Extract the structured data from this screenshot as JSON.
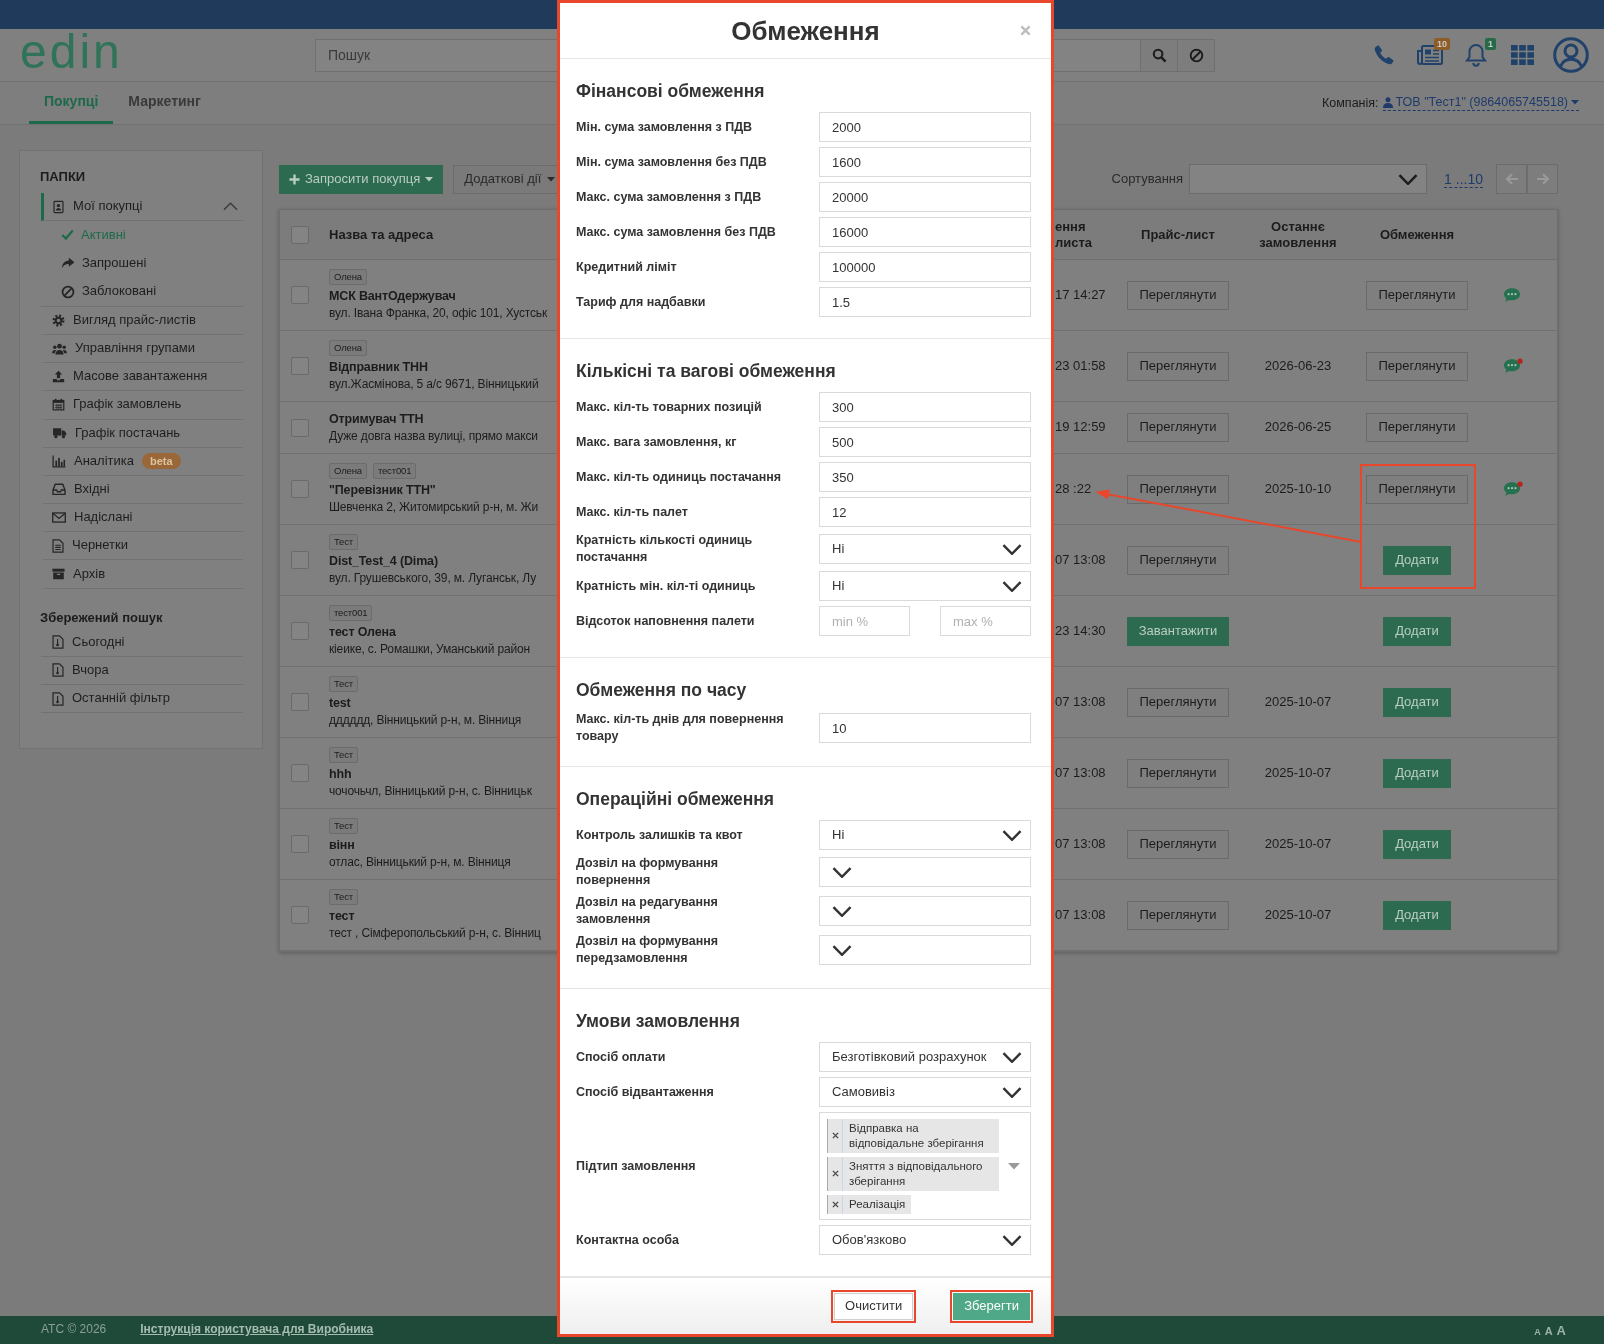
{
  "header": {
    "logo": "edin",
    "search": {
      "placeholder": "Пошук"
    },
    "icons": [
      {
        "kind": "phone"
      },
      {
        "kind": "news",
        "badge": "10",
        "color": "#8d5c27"
      },
      {
        "kind": "bell",
        "badge": "1",
        "color": "#276a48"
      },
      {
        "kind": "apps"
      },
      {
        "kind": "account"
      }
    ]
  },
  "tabs": [
    {
      "label": "Покупці",
      "selected": true
    },
    {
      "label": "Маркетинг",
      "selected": false
    }
  ],
  "company": {
    "label": "Компанія:",
    "value": "ТОВ \"Тест1\" (9864065745518)"
  },
  "sidebar": {
    "title": "ПАПКИ",
    "items": [
      {
        "label": "Мої покупці",
        "selected": true,
        "expanded": true,
        "children": [
          {
            "label": "Активні",
            "selected": true
          },
          {
            "label": "Запрошені",
            "selected": false
          },
          {
            "label": "Заблоковані",
            "selected": false
          }
        ]
      },
      {
        "label": "Вигляд прайс-листів",
        "selected": false
      },
      {
        "label": "Управління групами",
        "selected": false
      },
      {
        "label": "Масове завантаження",
        "selected": false
      },
      {
        "label": "Графік замовлень",
        "selected": false
      },
      {
        "label": "Графік постачань",
        "selected": false
      },
      {
        "label": "Аналітика",
        "badge": "beta",
        "selected": false
      },
      {
        "label": "Вхідні",
        "selected": false
      },
      {
        "label": "Надіслані",
        "selected": false
      },
      {
        "label": "Чернетки",
        "selected": false
      },
      {
        "label": "Архів",
        "selected": false
      }
    ],
    "saved_title": "Збережений пошук",
    "saved": [
      {
        "label": "Сьогодні",
        "selected": false
      },
      {
        "label": "Вчора",
        "selected": false
      },
      {
        "label": "Останній фільтр",
        "selected": false
      }
    ]
  },
  "toolbar": {
    "invite_button": "Запросити покупця",
    "actions_button": "Додаткові дії",
    "sort_label": "Сортування",
    "pagination": {
      "label": "1 ...10",
      "prev_disabled": true,
      "next_disabled": true
    }
  },
  "table": {
    "select_all": {
      "checked": false
    },
    "columns": [
      {
        "label": "Назва та адреса"
      },
      {
        "label": "ення листа"
      },
      {
        "label": "Прайс-лист"
      },
      {
        "label": "Останнє замовлення"
      },
      {
        "label": "Обмеження"
      }
    ],
    "rows": [
      {
        "checked": false,
        "tags": [
          "Олена"
        ],
        "name": "МСК ВантОдержувач",
        "address": "вул. Івана Франка, 20, офіс 101, Хустськ",
        "column_2": "17 14:27",
        "price_list": {
          "label": "Переглянути",
          "kind": "default"
        },
        "restrictions": {
          "label": "Переглянути",
          "kind": "default"
        },
        "chat": {
          "unread": false
        }
      },
      {
        "checked": false,
        "tags": [
          "Олена"
        ],
        "name": "Відправник ТНН",
        "address": "вул.Жасмінова, 5 а/с 9671, Вінницький",
        "column_2": "23 01:58",
        "price_list": {
          "label": "Переглянути",
          "kind": "default"
        },
        "last_order": "2026-06-23",
        "restrictions": {
          "label": "Переглянути",
          "kind": "default"
        },
        "chat": {
          "unread": true
        }
      },
      {
        "checked": false,
        "name": "Отримувач ТТН",
        "address": "Дуже довга назва вулиці, прямо макси",
        "column_2": "19 12:59",
        "price_list": {
          "label": "Переглянути",
          "kind": "default"
        },
        "last_order": "2026-06-25",
        "restrictions": {
          "label": "Переглянути",
          "kind": "default"
        }
      },
      {
        "checked": false,
        "tags": [
          "Олена",
          "тест001"
        ],
        "name": "\"Перевізник ТТН\"",
        "address": "Шевченка 2, Житомирський р-н, м. Жи",
        "column_2": "28 :22",
        "price_list": {
          "label": "Переглянути",
          "kind": "default"
        },
        "last_order": "2025-10-10",
        "restrictions": {
          "label": "Переглянути",
          "kind": "default"
        },
        "chat": {
          "unread": true
        }
      },
      {
        "checked": false,
        "tags": [
          "Тест"
        ],
        "name": "Dist_Test_4 (Dima)",
        "address": "вул. Грушевського, 39, м. Луганськ, Лу",
        "column_2": "07 13:08",
        "price_list": {
          "label": "Переглянути",
          "kind": "default"
        },
        "restrictions": {
          "label": "Додати",
          "kind": "primary"
        }
      },
      {
        "checked": false,
        "tags": [
          "тест001"
        ],
        "name": "тест Олена",
        "address": "кіеике, с. Ромашки, Уманський район",
        "column_2": "23 14:30",
        "price_list": {
          "label": "Завантажити",
          "kind": "primary"
        },
        "restrictions": {
          "label": "Додати",
          "kind": "primary"
        }
      },
      {
        "checked": false,
        "tags": [
          "Тест"
        ],
        "name": "test",
        "address": "дддддд, Вінницький р-н, м. Вінниця",
        "column_2": "07 13:08",
        "price_list": {
          "label": "Переглянути",
          "kind": "default"
        },
        "last_order": "2025-10-07",
        "restrictions": {
          "label": "Додати",
          "kind": "primary"
        }
      },
      {
        "checked": false,
        "tags": [
          "Тест"
        ],
        "name": "hhh",
        "address": "чочочьчл, Вінницький р-н, с. Вінницьк",
        "column_2": "07 13:08",
        "price_list": {
          "label": "Переглянути",
          "kind": "default"
        },
        "last_order": "2025-10-07",
        "restrictions": {
          "label": "Додати",
          "kind": "primary"
        }
      },
      {
        "checked": false,
        "tags": [
          "Тест"
        ],
        "name": "вінн",
        "address": "отлас, Вінницький р-н, м. Вінниця",
        "column_2": "07 13:08",
        "price_list": {
          "label": "Переглянути",
          "kind": "default"
        },
        "last_order": "2025-10-07",
        "restrictions": {
          "label": "Додати",
          "kind": "primary"
        }
      },
      {
        "checked": false,
        "tags": [
          "Тест"
        ],
        "name": "тест",
        "address": "тест , Сімферопольський р-н, с. Вінниц",
        "column_2": "07 13:08",
        "price_list": {
          "label": "Переглянути",
          "kind": "default"
        },
        "last_order": "2025-10-07",
        "restrictions": {
          "label": "Додати",
          "kind": "primary"
        }
      }
    ]
  },
  "modal": {
    "title": "Обмеження",
    "sections": [
      {
        "title": "Фінансові обмеження",
        "fields": [
          {
            "kind": "input",
            "label": "Мін. сума замовлення з ПДВ",
            "value": "2000"
          },
          {
            "kind": "input",
            "label": "Мін. сума замовлення без ПДВ",
            "value": "1600"
          },
          {
            "kind": "input",
            "label": "Макс. сума замовлення з ПДВ",
            "value": "20000"
          },
          {
            "kind": "input",
            "label": "Макс. сума замовлення без ПДВ",
            "value": "16000"
          },
          {
            "kind": "input",
            "label": "Кредитний ліміт",
            "value": "100000"
          },
          {
            "kind": "input",
            "label": "Тариф для надбавки",
            "value": "1.5"
          }
        ]
      },
      {
        "title": "Кількісні та вагові обмеження",
        "fields": [
          {
            "kind": "input",
            "label": "Макс. кіл-ть товарних позицій",
            "value": "300"
          },
          {
            "kind": "input",
            "label": "Макс. вага замовлення, кг",
            "value": "500"
          },
          {
            "kind": "input",
            "label": "Макс. кіл-ть одиниць постачання",
            "value": "350"
          },
          {
            "kind": "input",
            "label": "Макс. кіл-ть палет",
            "value": "12"
          },
          {
            "kind": "select",
            "label": "Кратність кількості одиниць постачання",
            "value": "Ні"
          },
          {
            "kind": "select",
            "label": "Кратність мін. кіл-ті одиниць",
            "value": "Ні"
          },
          {
            "kind": "range",
            "label": "Відсоток наповнення палети",
            "min_placeholder": "min %",
            "max_placeholder": "max %"
          }
        ]
      },
      {
        "title": "Обмеження по часу",
        "fields": [
          {
            "kind": "input",
            "label": "Макс. кіл-ть днів для повернення товару",
            "value": "10"
          }
        ]
      },
      {
        "title": "Операційні обмеження",
        "fields": [
          {
            "kind": "select",
            "label": "Контроль залишків та квот",
            "value": "Ні"
          },
          {
            "kind": "select",
            "label": "Дозвіл на формування повернення"
          },
          {
            "kind": "select",
            "label": "Дозвіл на редагування замовлення"
          },
          {
            "kind": "select",
            "label": "Дозвіл на формування передзамовлення"
          }
        ]
      },
      {
        "title": "Умови замовлення",
        "fields": [
          {
            "kind": "select",
            "label": "Спосіб оплати",
            "value": "Безготівковий розрахунок"
          },
          {
            "kind": "select",
            "label": "Спосіб відвантаження",
            "value": "Самовивіз"
          },
          {
            "kind": "multiselect",
            "label": "Підтип замовлення",
            "chips": [
              "Відправка на відповідальне зберігання",
              "Зняття з відповідального зберігання",
              "Реалізація"
            ]
          },
          {
            "kind": "select",
            "label": "Контактна особа",
            "value": "Обов'язково"
          }
        ]
      }
    ],
    "buttons": [
      {
        "label": "Очистити",
        "kind": "default"
      },
      {
        "label": "Зберегти",
        "kind": "primary"
      }
    ]
  },
  "footer": {
    "copyright": "АТС © 2026",
    "link": "Інструкція користувача для Виробника",
    "text_sizes": [
      {
        "label": "A",
        "kind": "small"
      },
      {
        "label": "A",
        "kind": "medium"
      },
      {
        "label": "A",
        "kind": "large"
      }
    ]
  }
}
